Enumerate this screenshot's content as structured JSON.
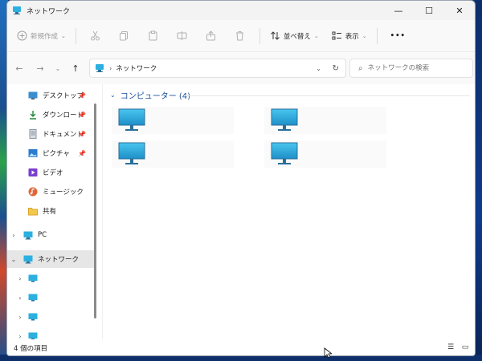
{
  "window": {
    "title": "ネットワーク",
    "controls": {
      "minimize": "—",
      "maximize": "☐",
      "close": "✕"
    }
  },
  "toolbar": {
    "new_label": "新規作成",
    "sort_label": "並べ替え",
    "view_label": "表示",
    "more_label": "•••"
  },
  "address": {
    "path": [
      "ネットワーク"
    ],
    "search_placeholder": "ネットワークの検索"
  },
  "sidebar": {
    "quick_access": [
      {
        "label": "デスクトップ",
        "pinned": true,
        "icon": "desktop-icon"
      },
      {
        "label": "ダウンロード",
        "pinned": true,
        "icon": "download-icon"
      },
      {
        "label": "ドキュメント",
        "pinned": true,
        "icon": "document-icon"
      },
      {
        "label": "ピクチャ",
        "pinned": true,
        "icon": "picture-icon"
      },
      {
        "label": "ビデオ",
        "pinned": false,
        "icon": "video-icon"
      },
      {
        "label": "ミュージック",
        "pinned": false,
        "icon": "music-icon"
      },
      {
        "label": "共有",
        "pinned": false,
        "icon": "folder-icon"
      }
    ],
    "pc_label": "PC",
    "network_label": "ネットワーク",
    "network_children_count": 4
  },
  "content": {
    "group_title": "コンピューター (4)",
    "items_count": 4
  },
  "status": {
    "item_count": "4 個の項目"
  },
  "colors": {
    "accent": "#1a4f9a",
    "monitor": "#2bb0e0",
    "selected_bg": "#e6e6e6"
  }
}
